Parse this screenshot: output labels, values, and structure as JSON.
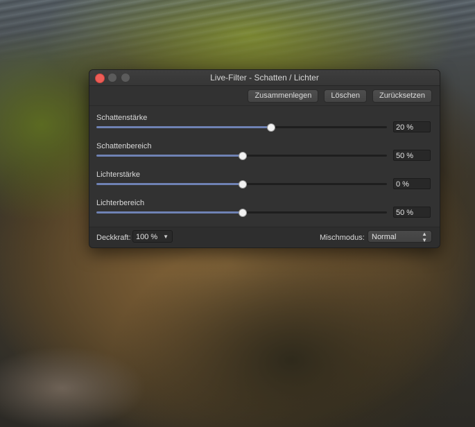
{
  "dialog": {
    "title": "Live-Filter - Schatten / Lichter",
    "buttons": {
      "merge": "Zusammenlegen",
      "delete": "Löschen",
      "reset": "Zurücksetzen"
    },
    "sliders": [
      {
        "label": "Schattenstärke",
        "value": "20 %",
        "position": 0.6
      },
      {
        "label": "Schattenbereich",
        "value": "50 %",
        "position": 0.5
      },
      {
        "label": "Lichterstärke",
        "value": "0 %",
        "position": 0.5
      },
      {
        "label": "Lichterbereich",
        "value": "50 %",
        "position": 0.5
      }
    ],
    "footer": {
      "opacity_label": "Deckkraft:",
      "opacity_value": "100 %",
      "blend_label": "Mischmodus:",
      "blend_value": "Normal"
    }
  },
  "colors": {
    "slider_fill": "#6f82b4",
    "close_button": "#ee5d57",
    "panel_bg": "#323232"
  }
}
